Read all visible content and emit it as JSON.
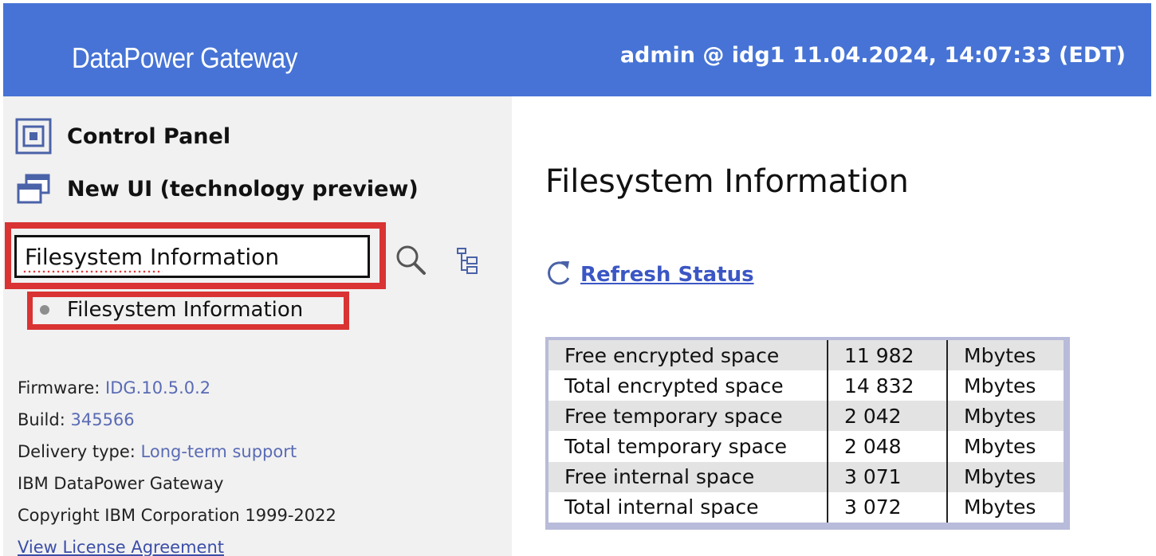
{
  "header": {
    "title": "DataPower Gateway",
    "user_info": "admin @ idg1 11.04.2024, 14:07:33 (EDT)"
  },
  "sidebar": {
    "nav": [
      {
        "label": "Control Panel",
        "icon": "control-panel-icon"
      },
      {
        "label": "New UI (technology preview)",
        "icon": "new-ui-windows-icon"
      }
    ],
    "search": {
      "value": "Filesystem Information",
      "search_icon": "magnifier-icon",
      "tree_icon": "tree-view-icon"
    },
    "suggestions": [
      {
        "label": "Filesystem Information"
      }
    ],
    "info": {
      "firmware_label": "Firmware:",
      "firmware_value": "IDG.10.5.0.2",
      "build_label": "Build:",
      "build_value": "345566",
      "delivery_label": "Delivery type:",
      "delivery_value": "Long-term support",
      "product": "IBM DataPower Gateway",
      "copyright": "Copyright IBM Corporation 1999-2022",
      "license_link": "View License Agreement"
    }
  },
  "main": {
    "title": "Filesystem Information",
    "refresh_label": "Refresh Status",
    "refresh_icon": "refresh-icon",
    "table": [
      {
        "label": "Free encrypted space",
        "value": "11 982",
        "unit": "Mbytes"
      },
      {
        "label": "Total encrypted space",
        "value": "14 832",
        "unit": "Mbytes"
      },
      {
        "label": "Free temporary space",
        "value": "2 042",
        "unit": "Mbytes"
      },
      {
        "label": "Total temporary space",
        "value": "2 048",
        "unit": "Mbytes"
      },
      {
        "label": "Free internal space",
        "value": "3 071",
        "unit": "Mbytes"
      },
      {
        "label": "Total internal space",
        "value": "3 072",
        "unit": "Mbytes"
      }
    ]
  },
  "colors": {
    "header_bg": "#4673d5",
    "sidebar_bg": "#f1f1f1",
    "highlight_outline": "#d93333",
    "link": "#3b56c4"
  }
}
